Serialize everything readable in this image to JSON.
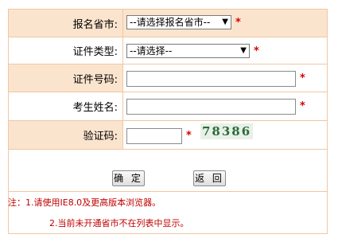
{
  "form": {
    "province": {
      "label": "报名省市:",
      "value": "--请选择报名省市--"
    },
    "cert_type": {
      "label": "证件类型:",
      "value": "--请选择--"
    },
    "cert_number": {
      "label": "证件号码:",
      "value": ""
    },
    "name": {
      "label": "考生姓名:",
      "value": ""
    },
    "captcha": {
      "label": "验证码:",
      "value": "",
      "image_text": "78386"
    },
    "required_mark": "*"
  },
  "buttons": {
    "confirm": "确 定",
    "back": "返 回"
  },
  "notes": {
    "line1": "注：1.请使用IE8.0及更高版本浏览器。",
    "line2": "2.当前未开通省市不在列表中显示。"
  },
  "colors": {
    "shade": "#fbe4ce",
    "border": "#f0c7a4",
    "required": "#d40000",
    "note": "#c00000"
  }
}
